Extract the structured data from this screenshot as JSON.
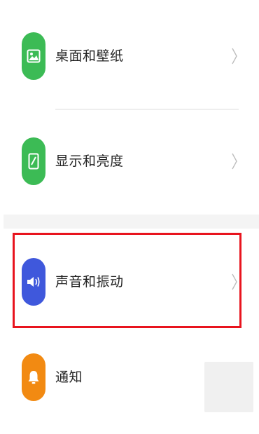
{
  "settings": {
    "items": [
      {
        "label": "桌面和壁纸",
        "icon": "wallpaper-icon",
        "color": "#3cbb55"
      },
      {
        "label": "显示和亮度",
        "icon": "display-phone-icon",
        "color": "#3cbb55"
      },
      {
        "label": "声音和振动",
        "icon": "speaker-icon",
        "color": "#3f58dc"
      },
      {
        "label": "通知",
        "icon": "bell-icon",
        "color": "#f28a12"
      }
    ]
  },
  "highlight_color": "#e8141e"
}
